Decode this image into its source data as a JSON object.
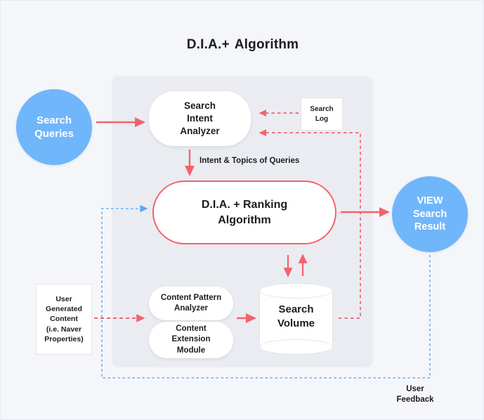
{
  "title": {
    "main": "D.I.A.+",
    "suffix": "Algorithm"
  },
  "colors": {
    "background": "#f4f6fa",
    "panel": "#eaecf1",
    "blue_circle": "#70b6fb",
    "red_accent": "#f5616f",
    "blue_dashed": "#79b8f5",
    "text": "#1c1c1e",
    "white": "#ffffff"
  },
  "nodes": {
    "search_queries": "Search\nQueries",
    "search_intent_analyzer": "Search\nIntent\nAnalyzer",
    "search_log": "Search\nLog",
    "dia_ranking": "D.I.A. + Ranking\nAlgorithm",
    "view_search_result": "VIEW\nSearch\nResult",
    "content_pattern_analyzer": "Content Pattern\nAnalyzer",
    "content_extension_module": "Content\nExtension\nModule",
    "search_volume": "Search\nVolume",
    "user_generated_content": "User\nGenerated\nContent\n(i.e. Naver\nProperties)"
  },
  "edge_labels": {
    "intent_topics": "Intent & Topics of Queries",
    "user_feedback": "User\nFeedback"
  },
  "edges": [
    {
      "from": "search_queries",
      "to": "search_intent_analyzer",
      "style": "solid",
      "color": "#f5616f"
    },
    {
      "from": "search_log",
      "to": "search_intent_analyzer",
      "style": "dashed",
      "color": "#f5616f"
    },
    {
      "from": "search_volume",
      "to": "search_intent_analyzer",
      "style": "dashed",
      "color": "#f5616f"
    },
    {
      "from": "search_intent_analyzer",
      "to": "dia_ranking",
      "style": "solid",
      "color": "#f5616f",
      "label": "Intent & Topics of Queries"
    },
    {
      "from": "dia_ranking",
      "to": "view_search_result",
      "style": "solid",
      "color": "#f5616f"
    },
    {
      "from": "dia_ranking",
      "to": "search_volume",
      "style": "solid",
      "color": "#f5616f",
      "bidirectional": true
    },
    {
      "from": "user_generated_content",
      "to": "content_pattern_analyzer",
      "style": "dashed",
      "color": "#f5616f"
    },
    {
      "from": "content_pattern_analyzer",
      "to": "search_volume",
      "style": "solid",
      "color": "#f5616f"
    },
    {
      "from": "view_search_result",
      "to": "dia_ranking",
      "style": "dotted",
      "color": "#79b8f5",
      "label": "User Feedback"
    }
  ]
}
